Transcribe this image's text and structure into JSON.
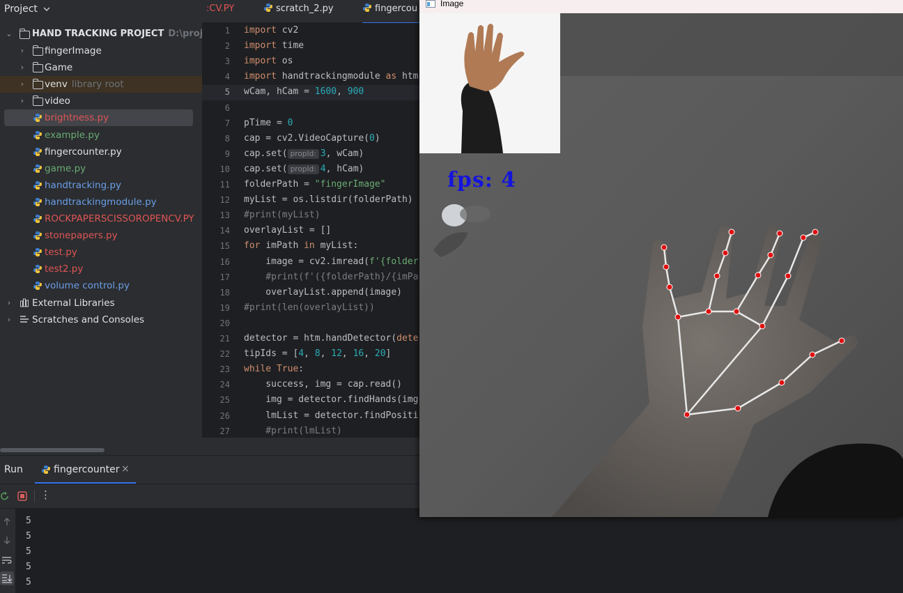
{
  "project": {
    "title": "Project",
    "root_name": "HAND TRACKING PROJECT",
    "root_path": "D:\\projects",
    "items": [
      {
        "label": "fingerImage",
        "type": "folder",
        "color": "#dfe1e5"
      },
      {
        "label": "Game",
        "type": "folder",
        "color": "#dfe1e5"
      },
      {
        "label": "venv",
        "hint": "library root",
        "type": "folder",
        "color": "#dfe1e5"
      },
      {
        "label": "video",
        "type": "folder",
        "color": "#dfe1e5"
      },
      {
        "label": "brightness.py",
        "type": "py",
        "color": "#e05555"
      },
      {
        "label": "example.py",
        "type": "py",
        "color": "#6aab73"
      },
      {
        "label": "fingercounter.py",
        "type": "py",
        "color": "#dfe1e5"
      },
      {
        "label": "game.py",
        "type": "py",
        "color": "#6aab73"
      },
      {
        "label": "handtracking.py",
        "type": "py",
        "color": "#6c9ee8"
      },
      {
        "label": "handtrackingmodule.py",
        "type": "py",
        "color": "#6c9ee8"
      },
      {
        "label": "ROCKPAPERSCISSOROPENCV.PY",
        "type": "py",
        "color": "#e05555"
      },
      {
        "label": "stonepapers.py",
        "type": "py",
        "color": "#e05555"
      },
      {
        "label": "test.py",
        "type": "py",
        "color": "#e05555"
      },
      {
        "label": "test2.py",
        "type": "py",
        "color": "#e05555"
      },
      {
        "label": "volume control.py",
        "type": "py",
        "color": "#6c9ee8"
      }
    ],
    "external_libraries": "External Libraries",
    "scratches": "Scratches and Consoles"
  },
  "tabs": [
    {
      "label": ":CV.PY",
      "color": "#e05555"
    },
    {
      "label": "scratch_2.py",
      "color": "#dfe1e5"
    },
    {
      "label": "fingercou",
      "color": "#dfe1e5",
      "active": true
    }
  ],
  "editor": {
    "current_line": 5,
    "line_numbers": [
      "1",
      "2",
      "3",
      "4",
      "5",
      "6",
      "7",
      "8",
      "9",
      "10",
      "11",
      "12",
      "13",
      "14",
      "15",
      "16",
      "17",
      "18",
      "19",
      "20",
      "21",
      "22",
      "23",
      "24",
      "25",
      "26",
      "27"
    ],
    "inlay_hint": "propId:",
    "lines": [
      [
        {
          "t": "import",
          "c": "kw"
        },
        {
          "t": " cv2"
        }
      ],
      [
        {
          "t": "import",
          "c": "kw"
        },
        {
          "t": " time"
        }
      ],
      [
        {
          "t": "import",
          "c": "kw"
        },
        {
          "t": " os"
        }
      ],
      [
        {
          "t": "import",
          "c": "kw"
        },
        {
          "t": " handtrackingmodule "
        },
        {
          "t": "as",
          "c": "kw"
        },
        {
          "t": " htm"
        }
      ],
      [
        {
          "t": "wCam, hCam = "
        },
        {
          "t": "1600",
          "c": "num"
        },
        {
          "t": ", "
        },
        {
          "t": "900",
          "c": "num"
        }
      ],
      [],
      [
        {
          "t": "pTime = "
        },
        {
          "t": "0",
          "c": "num"
        }
      ],
      [
        {
          "t": "cap = cv2.VideoCapture("
        },
        {
          "t": "0",
          "c": "num"
        },
        {
          "t": ")"
        }
      ],
      [
        {
          "t": "cap.set("
        },
        {
          "t": "propId:",
          "c": "inlay"
        },
        {
          "t": "3",
          "c": "num"
        },
        {
          "t": ", wCam)"
        }
      ],
      [
        {
          "t": "cap.set("
        },
        {
          "t": "propId:",
          "c": "inlay"
        },
        {
          "t": "4",
          "c": "num"
        },
        {
          "t": ", hCam)"
        }
      ],
      [
        {
          "t": "folderPath = "
        },
        {
          "t": "\"fingerImage\"",
          "c": "str"
        }
      ],
      [
        {
          "t": "myList = os.listdir(folderPath)"
        }
      ],
      [
        {
          "t": "#print(myList)",
          "c": "cmt"
        }
      ],
      [
        {
          "t": "overlayList = []"
        }
      ],
      [
        {
          "t": "for",
          "c": "kw"
        },
        {
          "t": " imPath "
        },
        {
          "t": "in",
          "c": "kw"
        },
        {
          "t": " myList:"
        }
      ],
      [
        {
          "t": "    image = cv2.imread("
        },
        {
          "t": "f'{folder",
          "c": "str"
        }
      ],
      [
        {
          "t": "    #print(f'({folderPath}/{imPa",
          "c": "cmt"
        }
      ],
      [
        {
          "t": "    overlayList.append(image)"
        }
      ],
      [
        {
          "t": "#print(len(overlayList))",
          "c": "cmt"
        }
      ],
      [],
      [
        {
          "t": "detector = htm.handDetector("
        },
        {
          "t": "dete",
          "c": "kw"
        }
      ],
      [
        {
          "t": "tipIds = ["
        },
        {
          "t": "4",
          "c": "num"
        },
        {
          "t": ", "
        },
        {
          "t": "8",
          "c": "num"
        },
        {
          "t": ", "
        },
        {
          "t": "12",
          "c": "num"
        },
        {
          "t": ", "
        },
        {
          "t": "16",
          "c": "num"
        },
        {
          "t": ", "
        },
        {
          "t": "20",
          "c": "num"
        },
        {
          "t": "]"
        }
      ],
      [
        {
          "t": "while",
          "c": "kw"
        },
        {
          "t": " "
        },
        {
          "t": "True",
          "c": "kw"
        },
        {
          "t": ":"
        }
      ],
      [
        {
          "t": "    success, img = cap.read()"
        }
      ],
      [
        {
          "t": "    img = detector.findHands(img"
        }
      ],
      [
        {
          "t": "    lmList = detector.findPositi"
        }
      ],
      [
        {
          "t": "    #print(lmList)",
          "c": "cmt"
        }
      ]
    ]
  },
  "run": {
    "label": "Run",
    "tab_label": "fingercounter",
    "console_lines": [
      "5",
      "5",
      "5",
      "5",
      "5"
    ]
  },
  "image_window": {
    "title": "Image",
    "fps_text": "fps: 4",
    "fps_color": "#1414dc",
    "landmark_color": "#e01010",
    "connection_color": "#e8e8e8"
  },
  "colors": {
    "accent": "#3574f0",
    "keyword": "#cf8e6d",
    "number": "#2aacb8",
    "string": "#6aab73",
    "comment": "#7a7e85"
  }
}
